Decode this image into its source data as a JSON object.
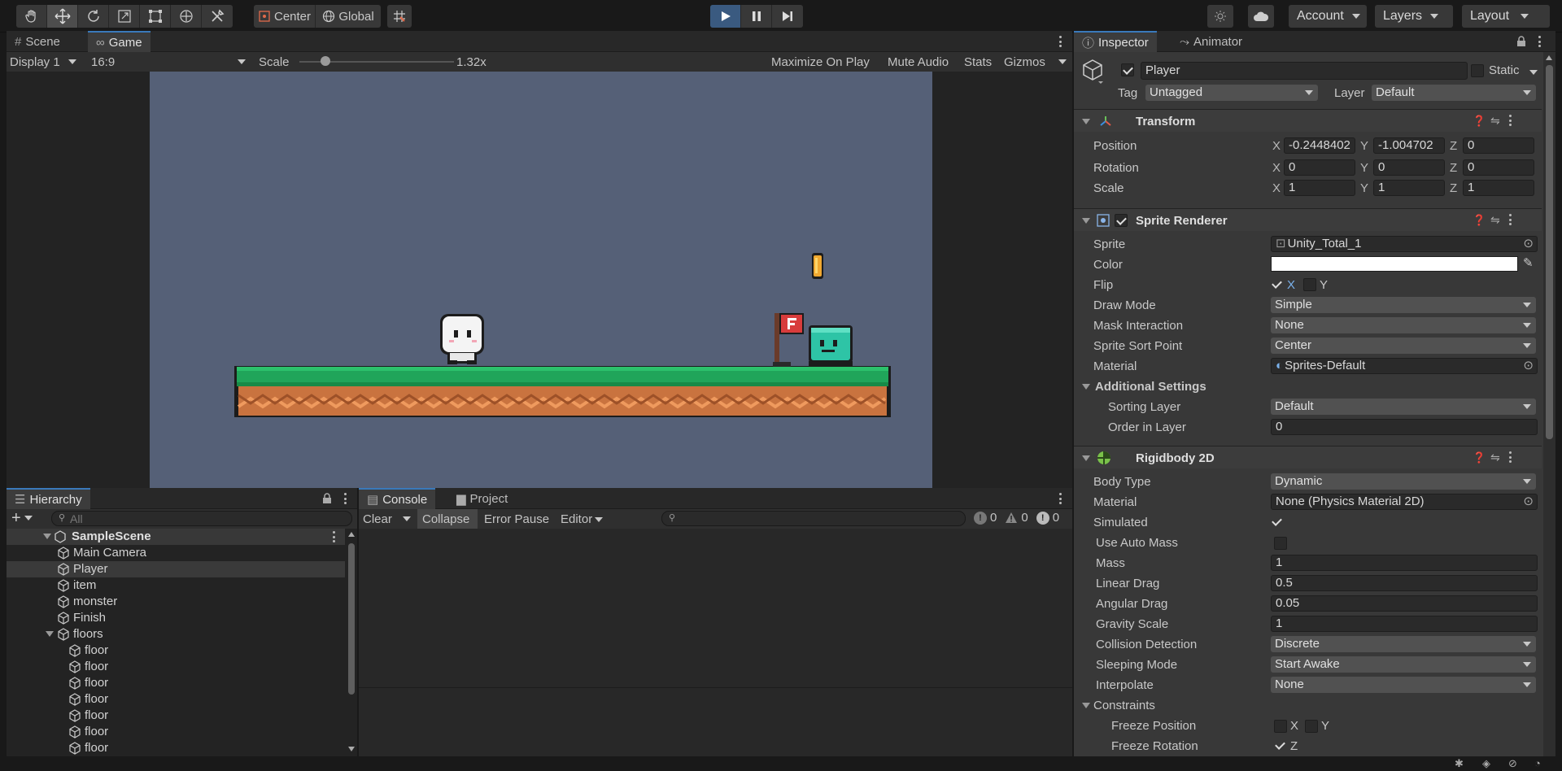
{
  "toolbar": {
    "pivot_center": "Center",
    "pivot_global": "Global",
    "account": "Account",
    "layers": "Layers",
    "layout": "Layout"
  },
  "scene_panel": {
    "tabs": [
      "Scene",
      "Game"
    ],
    "display": "Display 1",
    "aspect": "16:9",
    "scale_label": "Scale",
    "scale_value": "1.32x",
    "scale_fraction": 0.17,
    "maximize": "Maximize On Play",
    "mute": "Mute Audio",
    "stats": "Stats",
    "gizmos": "Gizmos"
  },
  "hierarchy": {
    "tab": "Hierarchy",
    "search_placeholder": "All",
    "scene": "SampleScene",
    "items": [
      {
        "label": "Main Camera",
        "depth": 1
      },
      {
        "label": "Player",
        "depth": 1,
        "selected": true
      },
      {
        "label": "item",
        "depth": 1
      },
      {
        "label": "monster",
        "depth": 1
      },
      {
        "label": "Finish",
        "depth": 1
      },
      {
        "label": "floors",
        "depth": 1,
        "expanded": true
      },
      {
        "label": "floor",
        "depth": 2
      },
      {
        "label": "floor",
        "depth": 2
      },
      {
        "label": "floor",
        "depth": 2
      },
      {
        "label": "floor",
        "depth": 2
      },
      {
        "label": "floor",
        "depth": 2
      },
      {
        "label": "floor",
        "depth": 2
      },
      {
        "label": "floor",
        "depth": 2
      }
    ]
  },
  "console": {
    "tabs": [
      "Console",
      "Project"
    ],
    "clear": "Clear",
    "collapse": "Collapse",
    "error_pause": "Error Pause",
    "editor": "Editor",
    "count_info": "0",
    "count_warn": "0",
    "count_error": "0"
  },
  "inspector": {
    "tabs": [
      "Inspector",
      "Animator"
    ],
    "object_name": "Player",
    "static_label": "Static",
    "tag_label": "Tag",
    "tag_value": "Untagged",
    "layer_label": "Layer",
    "layer_value": "Default",
    "transform": {
      "title": "Transform",
      "position_label": "Position",
      "pos_x": "-0.2448402",
      "pos_y": "-1.004702",
      "pos_z": "0",
      "rotation_label": "Rotation",
      "rot_x": "0",
      "rot_y": "0",
      "rot_z": "0",
      "scale_label": "Scale",
      "scl_x": "1",
      "scl_y": "1",
      "scl_z": "1"
    },
    "sprite_renderer": {
      "title": "Sprite Renderer",
      "sprite_label": "Sprite",
      "sprite_value": "Unity_Total_1",
      "color_label": "Color",
      "color_value": "#ffffff",
      "flip_label": "Flip",
      "flip_x": "X",
      "flip_y": "Y",
      "draw_mode_label": "Draw Mode",
      "draw_mode": "Simple",
      "mask_label": "Mask Interaction",
      "mask_value": "None",
      "sort_point_label": "Sprite Sort Point",
      "sort_point": "Center",
      "material_label": "Material",
      "material_value": "Sprites-Default",
      "additional_label": "Additional Settings",
      "sorting_layer_label": "Sorting Layer",
      "sorting_layer": "Default",
      "order_label": "Order in Layer",
      "order_value": "0"
    },
    "rigidbody": {
      "title": "Rigidbody 2D",
      "body_type_label": "Body Type",
      "body_type": "Dynamic",
      "material_label": "Material",
      "material_value": "None (Physics Material 2D)",
      "simulated_label": "Simulated",
      "auto_mass_label": "Use Auto Mass",
      "mass_label": "Mass",
      "mass": "1",
      "linear_drag_label": "Linear Drag",
      "linear_drag": "0.5",
      "angular_drag_label": "Angular Drag",
      "angular_drag": "0.05",
      "gravity_label": "Gravity Scale",
      "gravity": "1",
      "collision_label": "Collision Detection",
      "collision": "Discrete",
      "sleeping_label": "Sleeping Mode",
      "sleeping": "Start Awake",
      "interpolate_label": "Interpolate",
      "interpolate": "None",
      "constraints_label": "Constraints",
      "freeze_pos_label": "Freeze Position",
      "freeze_x": "X",
      "freeze_y": "Y",
      "freeze_rot_label": "Freeze Rotation",
      "freeze_z": "Z"
    }
  },
  "colors": {
    "game_bg": "#556077",
    "grass": "#20a55a",
    "dirt": "#c9733f",
    "accent": "#3a79bb"
  }
}
